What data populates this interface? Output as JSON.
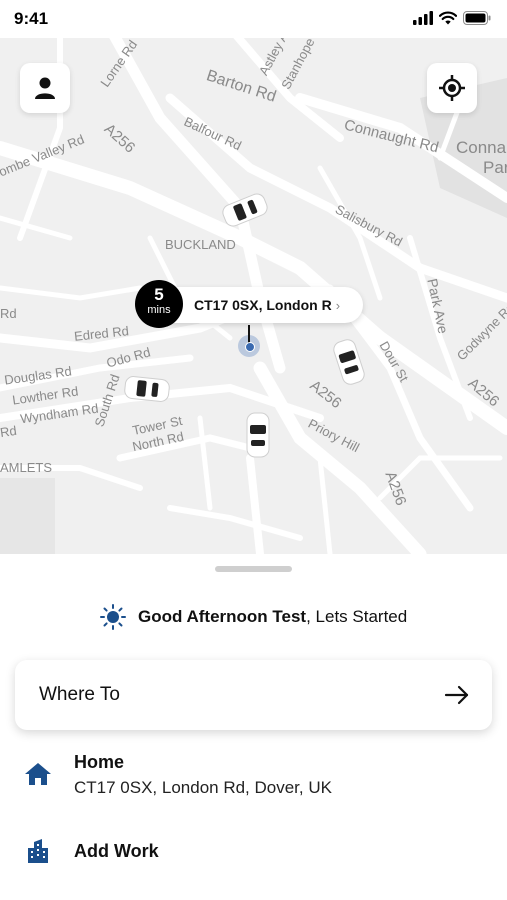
{
  "status_bar": {
    "time": "9:41"
  },
  "map": {
    "labels": {
      "barton_rd": "Barton Rd",
      "balfour_rd": "Balfour Rd",
      "connaught_rd": "Connaught Rd",
      "connaught_park": "Conna",
      "connaught_park2": "Par",
      "a256_top": "A256",
      "combe_valley": "ombe Valley Rd",
      "lorne_rd": "Lorne Rd",
      "astley_av": "Astley A",
      "stanhope": "Stanhope",
      "buckland": "BUCKLAND",
      "salisbury_rd": "Salisbury Rd",
      "park_ave": "Park Ave",
      "godwyne_rd": "Godwyne Rd",
      "edred_rd": "Edred Rd",
      "odo_rd": "Odo Rd",
      "douglas_rd": "Douglas Rd",
      "lowther_rd": "Lowther Rd",
      "wyndham_rd": "Wyndham Rd",
      "south_rd": "South Rd",
      "tower_st": "Tower St",
      "north_rd": "North Rd",
      "a256_mid": "A256",
      "priory_hill": "Priory Hill",
      "a256_low": "A256",
      "a256_right": "A256",
      "dour_st": "Dour St",
      "hamlets": "AMLETS",
      "rd_left": "Rd",
      "rd_left2": "Rd"
    },
    "eta": {
      "value": "5",
      "unit": "mins"
    },
    "pickup_address": "CT17 0SX, London R"
  },
  "sheet": {
    "greeting_name": "Good Afternoon Test",
    "greeting_rest": ", Lets Started",
    "where_to_label": "Where To",
    "saved": [
      {
        "title": "Home",
        "subtitle": "CT17 0SX, London Rd, Dover, UK",
        "icon": "home-icon"
      },
      {
        "title": "Add Work",
        "icon": "building-icon"
      }
    ]
  },
  "colors": {
    "accent_blue": "#1b4f8c",
    "map_bg": "#f1f1f1"
  }
}
